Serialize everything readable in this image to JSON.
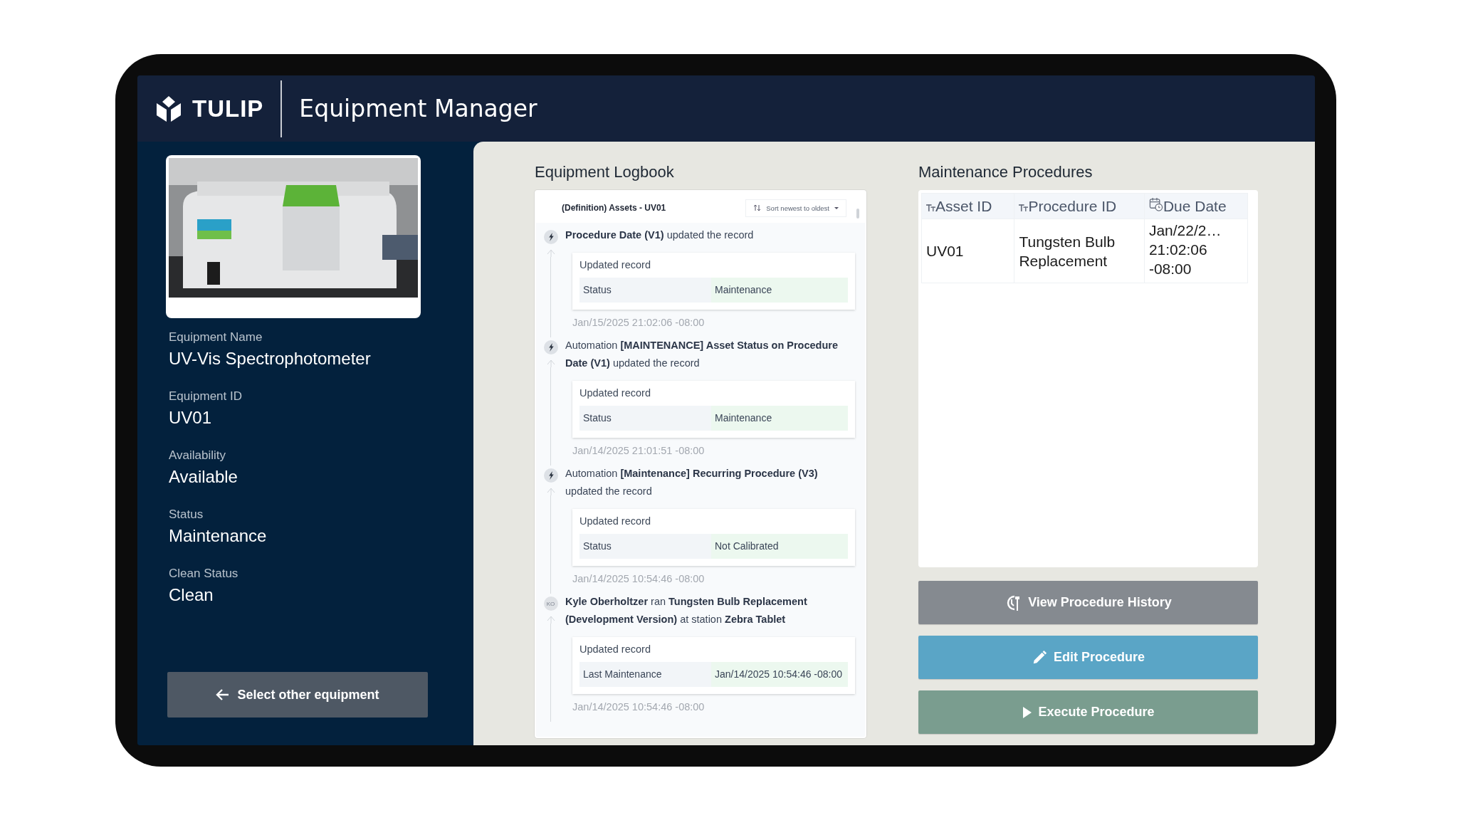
{
  "header": {
    "logo_text": "TULIP",
    "title": "Equipment Manager"
  },
  "equipment": {
    "fields": [
      {
        "label": "Equipment Name",
        "value": "UV-Vis Spectrophotometer"
      },
      {
        "label": "Equipment ID",
        "value": "UV01"
      },
      {
        "label": "Availability",
        "value": "Available"
      },
      {
        "label": "Status",
        "value": "Maintenance"
      },
      {
        "label": "Clean Status",
        "value": "Clean"
      }
    ],
    "select_button": "Select other equipment"
  },
  "logbook": {
    "title": "Equipment Logbook",
    "record": "(Definition) Assets - UV01",
    "sort": "Sort newest to oldest",
    "entries": [
      {
        "kind": "automation",
        "text": "**Procedure Date (V1)** updated the record",
        "card_title": "Updated record",
        "field": "Status",
        "value": "Maintenance",
        "time": "Jan/15/2025 21:02:06 -08:00"
      },
      {
        "kind": "automation",
        "text": "Automation **[MAINTENANCE] Asset Status on Procedure Date (V1)** updated the record",
        "card_title": "Updated record",
        "field": "Status",
        "value": "Maintenance",
        "time": "Jan/14/2025 21:01:51 -08:00"
      },
      {
        "kind": "automation",
        "text": "Automation **[Maintenance] Recurring Procedure (V3)** updated the record",
        "card_title": "Updated record",
        "field": "Status",
        "value": "Not Calibrated",
        "time": "Jan/14/2025 10:54:46 -08:00"
      },
      {
        "kind": "user",
        "initials": "KO",
        "text": "**Kyle Oberholtzer** ran **Tungsten Bulb Replacement (Development Version)** at station **Zebra Tablet**",
        "card_title": "Updated record",
        "field": "Last Maintenance",
        "value": "Jan/14/2025 10:54:46 -08:00",
        "time": "Jan/14/2025 10:54:46 -08:00"
      }
    ]
  },
  "procedures": {
    "title": "Maintenance Procedures",
    "columns": [
      {
        "label": "Asset ID",
        "kind": "text"
      },
      {
        "label": "Procedure ID",
        "kind": "text"
      },
      {
        "label": "Due Date",
        "kind": "date"
      }
    ],
    "rows": [
      [
        "UV01",
        "Tungsten Bulb Replacement",
        "Jan/22/2…\n21:02:06\n-08:00"
      ]
    ],
    "buttons": [
      {
        "label": "View Procedure History",
        "kind": "history"
      },
      {
        "label": "Edit Procedure",
        "kind": "edit"
      },
      {
        "label": "Execute Procedure",
        "kind": "play"
      }
    ]
  }
}
